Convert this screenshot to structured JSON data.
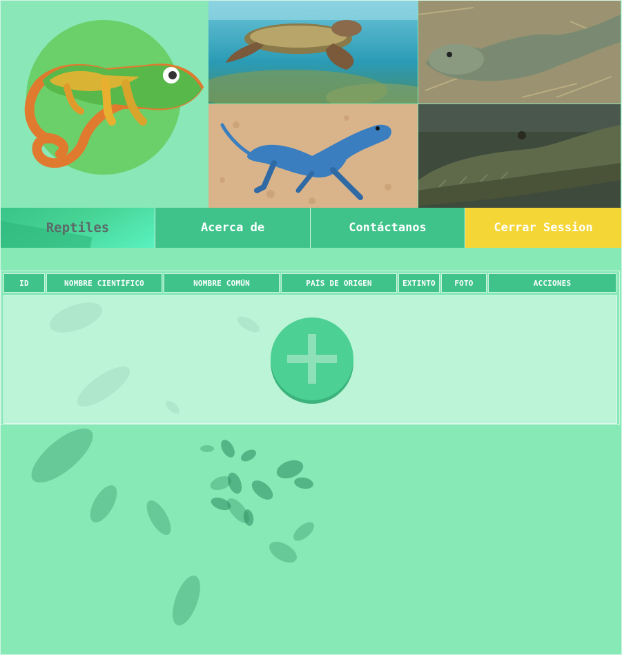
{
  "nav": {
    "brand": "Reptiles",
    "about": "Acerca de",
    "contact": "Contáctanos",
    "logout": "Cerrar Session"
  },
  "table": {
    "columns": [
      "ID",
      "NOMBRE CIENTÍFICO",
      "NOMBRE COMÚN",
      "PAÍS DE ORIGEN",
      "EXTINTO",
      "FOTO",
      "ACCIONES"
    ]
  },
  "header_images": [
    "chameleon-logo",
    "sea-turtle-photo",
    "iguana-photo",
    "blue-lizard-photo",
    "crocodile-photo"
  ],
  "colors": {
    "background": "#86e9b6",
    "nav": "#3fc38b",
    "logout": "#f4d636",
    "add_button": "#4cd093"
  }
}
